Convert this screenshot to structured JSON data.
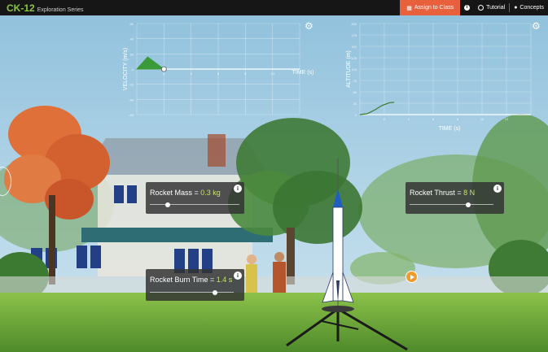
{
  "app": {
    "logo": "CK-12",
    "series": "Exploration Series"
  },
  "topbar": {
    "assign_label": "Assign to Class",
    "tutorial_label": "Tutorial",
    "concepts_label": "Concepts"
  },
  "graphs": {
    "velocity": {
      "ylabel": "VELOCITY (m/s)",
      "xlabel": "TIME (s)",
      "y_ticks": [
        "60",
        "40",
        "20",
        "0",
        "-20",
        "-40",
        "-60"
      ],
      "x_ticks": [
        "2",
        "4",
        "6",
        "8",
        "10"
      ],
      "series_color": "#3a9a3a",
      "points": [
        [
          0,
          0
        ],
        [
          0.8,
          16
        ],
        [
          2,
          0
        ]
      ]
    },
    "altitude": {
      "ylabel": "ALTITUDE (m)",
      "xlabel": "TIME (s)",
      "y_ticks": [
        "200",
        "175",
        "150",
        "125",
        "100",
        "75",
        "50",
        "25",
        "0"
      ],
      "x_ticks": [
        "2",
        "4",
        "6",
        "8",
        "10",
        "12"
      ],
      "series_color": "#3a7a2a",
      "points": [
        [
          0,
          0
        ],
        [
          0.6,
          2
        ],
        [
          1.2,
          10
        ],
        [
          1.8,
          20
        ],
        [
          2.4,
          26
        ],
        [
          2.8,
          27
        ]
      ]
    }
  },
  "controls": {
    "mass": {
      "label": "Rocket Mass = ",
      "value": "0.3 kg",
      "level": 0.2
    },
    "thrust": {
      "label": "Rocket Thrust = ",
      "value": "8 N",
      "level": 0.7
    },
    "burn": {
      "label": "Rocket Burn Time = ",
      "value": "1.4 s",
      "level": 0.78
    }
  },
  "colors": {
    "accent": "#e8603c",
    "value_text": "#c9e26e",
    "play": "#f29a2b"
  }
}
